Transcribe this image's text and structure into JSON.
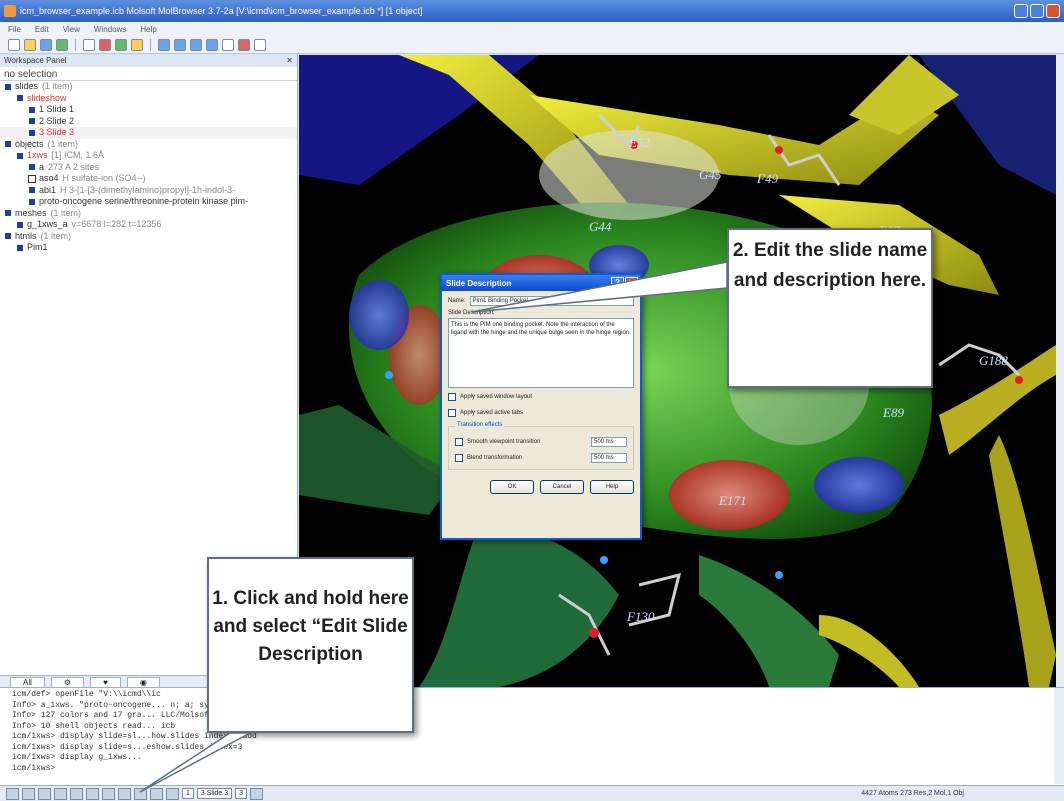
{
  "window": {
    "title": "icm_browser_example.icb Molsoft MolBrowser 3.7-2a [V:\\icmd\\icm_browser_example.icb *] [1 object]"
  },
  "menu": [
    "File",
    "Edit",
    "View",
    "Windows",
    "Help"
  ],
  "workspace": {
    "header": "Workspace Panel",
    "no_selection": "no selection",
    "tree": [
      {
        "label": "slides",
        "count": "(1 item)",
        "indent": 0,
        "style": ""
      },
      {
        "label": "slideshow",
        "count": "",
        "indent": 1,
        "style": "red"
      },
      {
        "label": "1 Slide 1",
        "count": "",
        "indent": 2,
        "style": ""
      },
      {
        "label": "2 Slide 2",
        "count": "",
        "indent": 2,
        "style": ""
      },
      {
        "label": "3 Slide 3",
        "count": "",
        "indent": 2,
        "style": "red highlight"
      },
      {
        "label": "objects",
        "count": "(1 item)",
        "indent": 0,
        "style": ""
      },
      {
        "label": "1xws",
        "count": "[1] ICM, 1.6Å",
        "indent": 1,
        "style": "red"
      },
      {
        "label": "a",
        "count": "273 A  2 sites",
        "indent": 2,
        "style": ""
      },
      {
        "label": "aso4",
        "count": "H  sulfate-ion (SO4--)",
        "indent": 2,
        "style": ""
      },
      {
        "label": "abi1",
        "count": "H  3-[1-[3-(dimethylamino)propyl]-1h-indol-3-",
        "indent": 2,
        "style": ""
      },
      {
        "label": "proto-oncogene serine/threonine-protein kinase pim-",
        "count": "",
        "indent": 2,
        "style": ""
      },
      {
        "label": "meshes",
        "count": "(1 item)",
        "indent": 0,
        "style": ""
      },
      {
        "label": "g_1xws_a",
        "count": "v=6678 l=282 t=12356",
        "indent": 1,
        "style": ""
      },
      {
        "label": "htmls",
        "count": "(1 item)",
        "indent": 0,
        "style": ""
      },
      {
        "label": "Pim1",
        "count": "",
        "indent": 1,
        "style": ""
      }
    ],
    "tabs": [
      "All",
      "",
      "",
      ""
    ]
  },
  "viewport": {
    "residue_labels": [
      "E52",
      "G45",
      "F49",
      "G44",
      "G188",
      "E171",
      "F130",
      "E89",
      "E67"
    ]
  },
  "dialog": {
    "title": "Slide Description",
    "name_label": "Name:",
    "name_value": "Pim1 Binding Pocket",
    "desc_label": "Slide Description:",
    "desc_value": "This is the PIM one binding pocket. Note the interaction of the ligand with the hinge and the unique bulge seen in the hinge region.",
    "chk_layout": "Apply saved window layout",
    "chk_tabs": "Apply saved active tabs",
    "transition_label": "Transition effects",
    "chk_smooth": "Smooth viewpoint transition",
    "smooth_ms": "500 ms",
    "chk_blend": "Blend transformation",
    "blend_ms": "500 ms",
    "ok": "OK",
    "cancel": "Cancel",
    "help": "Help"
  },
  "callouts": {
    "one": "1. Click and hold here and select “Edit Slide Description",
    "two": "2. Edit the slide name and description here."
  },
  "console": {
    "lines": [
      "icm/def> openFile \"V:\\\\icmd\\\\ic",
      "  Info> a_1xws. \"proto-oncogene...                                     n; a; synonym: pim1; ec: 2.7.1.37; engineered: yes\"",
      "  Info> 127 colors and 17 gra...                                       LLC/Molsoft ICM-Browser-Pro_8/icm.clr",
      "  Info> 10 shell objects read...                                       icb",
      "icm/1xws> display slide=sl...how.slides index=1 add",
      "icm/1xws> display slide=s...eshow.slides index=3",
      "icm/1xws> display g_1xws...",
      "icm/1xws> "
    ]
  },
  "statusbar": {
    "page": "1",
    "slide": "3 Slide 3",
    "count": "3",
    "info": "4427 Atoms 273 Res,2 Mol,1 Obj"
  }
}
